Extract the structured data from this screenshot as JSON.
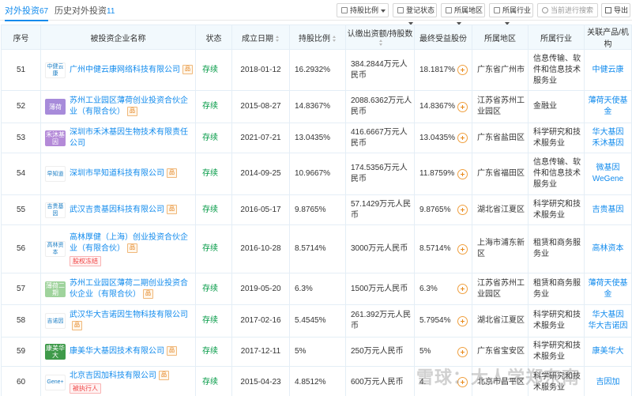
{
  "tabs": {
    "active_label": "对外投资",
    "active_count": "67",
    "history_label": "历史对外投资",
    "history_count": "11"
  },
  "filters": {
    "ratio": "持股比例",
    "status": "登记状态",
    "region": "所属地区",
    "industry": "所属行业",
    "search_placeholder": "当前进行搜索",
    "export": "导出"
  },
  "columns": {
    "no": "序号",
    "company": "被投资企业名称",
    "status": "状态",
    "date": "成立日期",
    "ratio": "持股比例",
    "capital": "认缴出资额/持股数",
    "final": "最终受益股份",
    "region": "所属地区",
    "industry": "所属行业",
    "products": "关联产品/机构"
  },
  "colors": {
    "accent": "#128bed",
    "status_green": "#009944",
    "risk_red": "#f04040"
  },
  "rows": [
    {
      "no": "51",
      "logo": "中健云康",
      "logo_bg": "#ffffff",
      "logo_img": true,
      "name": "广州中健云康网络科技有限公司",
      "tag": "品",
      "risk": "",
      "status": "存续",
      "date": "2018-01-12",
      "ratio": "16.2932%",
      "capital": [
        "384.2844万元人",
        "民币"
      ],
      "final": "18.1817%",
      "region": "广东省广州市",
      "industry": [
        "信息传输、软",
        "件和信息技术",
        "服务业"
      ],
      "products": [
        "中健云康"
      ]
    },
    {
      "no": "52",
      "logo": "薄荷",
      "logo_bg": "#a78bda",
      "logo_img": false,
      "name": "苏州工业园区薄荷创业投资合伙企业（有限合伙）",
      "tag": "品",
      "risk": "",
      "status": "存续",
      "date": "2015-08-27",
      "ratio": "14.8367%",
      "capital": [
        "2088.6362万元人",
        "民币"
      ],
      "final": "14.8367%",
      "region": "江苏省苏州工业园区",
      "industry": [
        "金融业"
      ],
      "products": [
        "薄荷天使基金"
      ]
    },
    {
      "no": "53",
      "logo": "禾沐基因",
      "logo_bg": "#b48ad8",
      "logo_img": false,
      "name": "深圳市禾沐基因生物技术有限责任公司",
      "tag": "",
      "risk": "",
      "status": "存续",
      "date": "2021-07-21",
      "ratio": "13.0435%",
      "capital": [
        "416.6667万元人",
        "民币"
      ],
      "final": "13.0435%",
      "region": "广东省盐田区",
      "industry": [
        "科学研究和技",
        "术服务业"
      ],
      "products": [
        "华大基因",
        "禾沐基因"
      ]
    },
    {
      "no": "54",
      "logo": "早知道",
      "logo_bg": "#ffffff",
      "logo_img": true,
      "name": "深圳市早知道科技有限公司",
      "tag": "品",
      "risk": "",
      "status": "存续",
      "date": "2014-09-25",
      "ratio": "10.9667%",
      "capital": [
        "174.5356万元人",
        "民币"
      ],
      "final": "11.8759%",
      "region": "广东省福田区",
      "industry": [
        "信息传输、软",
        "件和信息技术",
        "服务业"
      ],
      "products": [
        "微基因WeGene"
      ]
    },
    {
      "no": "55",
      "logo": "吉贵基因",
      "logo_bg": "#ffffff",
      "logo_img": true,
      "name": "武汉吉贵基因科技有限公司",
      "tag": "品",
      "risk": "",
      "status": "存续",
      "date": "2016-05-17",
      "ratio": "9.8765%",
      "capital": [
        "57.1429万元人民",
        "币"
      ],
      "final": "9.8765%",
      "region": "湖北省江夏区",
      "industry": [
        "科学研究和技",
        "术服务业"
      ],
      "products": [
        "吉贵基因"
      ]
    },
    {
      "no": "56",
      "logo": "高林资本",
      "logo_bg": "#ffffff",
      "logo_img": true,
      "name": "高林厚健（上海）创业投资合伙企业（有限合伙）",
      "tag": "品",
      "risk": "股权冻结",
      "status": "存续",
      "date": "2016-10-28",
      "ratio": "8.5714%",
      "capital": [
        "3000万元人民币"
      ],
      "final": "8.5714%",
      "region": "上海市浦东新区",
      "industry": [
        "租赁和商务服",
        "务业"
      ],
      "products": [
        "高林资本"
      ]
    },
    {
      "no": "57",
      "logo": "薄荷二期",
      "logo_bg": "#9fd39c",
      "logo_img": false,
      "name": "苏州工业园区薄荷二期创业投资合伙企业（有限合伙）",
      "tag": "品",
      "risk": "",
      "status": "存续",
      "date": "2019-05-20",
      "ratio": "6.3%",
      "capital": [
        "1500万元人民币"
      ],
      "final": "6.3%",
      "region": "江苏省苏州工业园区",
      "industry": [
        "租赁和商务服",
        "务业"
      ],
      "products": [
        "薄荷天使基金"
      ]
    },
    {
      "no": "58",
      "logo": "吉诺因",
      "logo_bg": "#ffffff",
      "logo_img": true,
      "name": "武汉华大吉诺因生物科技有限公司",
      "tag": "品",
      "risk": "",
      "status": "存续",
      "date": "2017-02-16",
      "ratio": "5.4545%",
      "capital": [
        "261.392万元人民",
        "币"
      ],
      "final": "5.7954%",
      "region": "湖北省江夏区",
      "industry": [
        "科学研究和技",
        "术服务业"
      ],
      "products": [
        "华大基因",
        "华大吉诺因"
      ]
    },
    {
      "no": "59",
      "logo": "康美华大",
      "logo_bg": "#3e9a4a",
      "logo_img": false,
      "name": "康美华大基因技术有限公司",
      "tag": "品",
      "risk": "",
      "status": "存续",
      "date": "2017-12-11",
      "ratio": "5%",
      "capital": [
        "250万元人民币"
      ],
      "final": "5%",
      "region": "广东省宝安区",
      "industry": [
        "科学研究和技",
        "术服务业"
      ],
      "products": [
        "康美华大"
      ]
    },
    {
      "no": "60",
      "logo": "Gene+",
      "logo_bg": "#ffffff",
      "logo_img": true,
      "name": "北京吉因加科技有限公司",
      "tag": "品",
      "risk": "被执行人",
      "status": "存续",
      "date": "2015-04-23",
      "ratio": "4.8512%",
      "capital": [
        "600万元人民币"
      ],
      "final": "4.",
      "region": "北京市昌平区",
      "industry": [
        "科学研究和技",
        "术服务业"
      ],
      "products": [
        "吉因加"
      ]
    }
  ],
  "watermark": "雪球：大人学郑东南"
}
